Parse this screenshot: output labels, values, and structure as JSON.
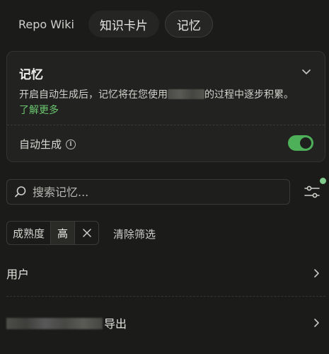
{
  "tabs": [
    {
      "label": "Repo Wiki"
    },
    {
      "label": "知识卡片"
    },
    {
      "label": "记忆"
    }
  ],
  "memory_card": {
    "title": "记忆",
    "description_before": "开启自动生成后，记忆将在您使用",
    "description_after": "的过程中逐步积累。",
    "learn_more": "了解更多",
    "auto_generate_label": "自动生成",
    "auto_generate_on": true
  },
  "search": {
    "placeholder": "搜索记忆..."
  },
  "filter": {
    "field_label": "成熟度",
    "value": "高",
    "clear_label": "清除筛选",
    "active_dot_color": "#7fc98a"
  },
  "list": [
    {
      "label": "用户"
    },
    {
      "label": "导出"
    }
  ],
  "colors": {
    "accent_green": "#4fb05a",
    "link_green": "#6ac76f"
  }
}
